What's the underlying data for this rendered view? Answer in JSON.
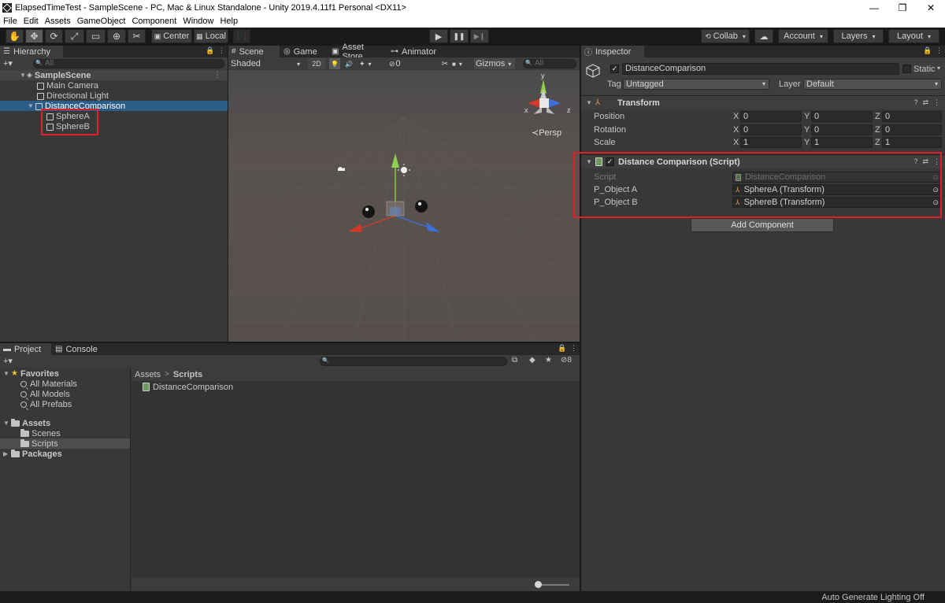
{
  "window": {
    "title": "ElapsedTimeTest - SampleScene - PC, Mac & Linux Standalone - Unity 2019.4.11f1 Personal <DX11>",
    "controls": [
      "—",
      "❐",
      "✕"
    ]
  },
  "menu": [
    "File",
    "Edit",
    "Assets",
    "GameObject",
    "Component",
    "Window",
    "Help"
  ],
  "toolbar": {
    "pivot": "Center",
    "space": "Local",
    "collab": "Collab",
    "account": "Account",
    "layers": "Layers",
    "layout": "Layout",
    "caret": "▾",
    "tools": [
      "✋",
      "✥",
      "⟳",
      "⤢",
      "▭",
      "⊕",
      "✂"
    ],
    "play": "▶",
    "pause": "❚❚",
    "step": "▶❙",
    "cloud": "☁",
    "grid_icon": "⋮⋮"
  },
  "hierarchy": {
    "tab": "Hierarchy",
    "add": "+▾",
    "search_placeholder": "All",
    "scene": "SampleScene",
    "items": [
      "Main Camera",
      "Directional Light",
      "DistanceComparison"
    ],
    "children": [
      "SphereA",
      "SphereB"
    ],
    "expanded_arrow": "▼",
    "menu_dots": "⋮"
  },
  "scene": {
    "tabs": [
      "Scene",
      "Game",
      "Asset Store",
      "Animator"
    ],
    "shading": "Shaded",
    "mode_2d": "2D",
    "hidden_count": "0",
    "gizmos": "Gizmos",
    "search_placeholder": "All",
    "persp": "≺Persp",
    "gizmo_x": "x",
    "gizmo_z": "z",
    "gizmo_y": "y",
    "toolbar_icons": {
      "light": "💡",
      "audio": "🔊",
      "fx": "✦",
      "hidden": "⊘",
      "tools": "✂",
      "camera": "■"
    }
  },
  "inspector": {
    "tab": "Inspector",
    "object_name": "DistanceComparison",
    "static_label": "Static",
    "tag_label": "Tag",
    "tag_value": "Untagged",
    "layer_label": "Layer",
    "layer_value": "Default",
    "check": "✓",
    "header_icons": [
      "?",
      "⇄",
      "⋮"
    ],
    "transform": {
      "title": "Transform",
      "position_label": "Position",
      "rotation_label": "Rotation",
      "scale_label": "Scale",
      "position": [
        "0",
        "0",
        "0"
      ],
      "rotation": [
        "0",
        "0",
        "0"
      ],
      "scale": [
        "1",
        "1",
        "1"
      ],
      "axes": [
        "X",
        "Y",
        "Z"
      ]
    },
    "script_component": {
      "title": "Distance Comparison (Script)",
      "script_label": "Script",
      "script_value": "DistanceComparison",
      "object_a_label": "P_Object A",
      "object_a_value": "SphereA (Transform)",
      "object_b_label": "P_Object B",
      "object_b_value": "SphereB (Transform)",
      "transform_glyph": "⅄",
      "picker": "⊙"
    },
    "add_component": "Add Component"
  },
  "project": {
    "tabs": [
      "Project",
      "Console"
    ],
    "add": "+▾",
    "favorites_label": "Favorites",
    "favorites": [
      "All Materials",
      "All Models",
      "All Prefabs"
    ],
    "assets_label": "Assets",
    "asset_folders": [
      "Scenes",
      "Scripts"
    ],
    "packages_label": "Packages",
    "breadcrumb_root": "Assets",
    "breadcrumb_sep": ">",
    "breadcrumb_current": "Scripts",
    "files": [
      "DistanceComparison"
    ],
    "hidden_count": "8",
    "star": "★",
    "toolbar_icons": [
      "⧉",
      "◆",
      "★",
      "⊘"
    ]
  },
  "status": {
    "right": "Auto Generate Lighting Off"
  },
  "colors": {
    "highlight": "#d8232a",
    "selection": "#2c5d87"
  }
}
